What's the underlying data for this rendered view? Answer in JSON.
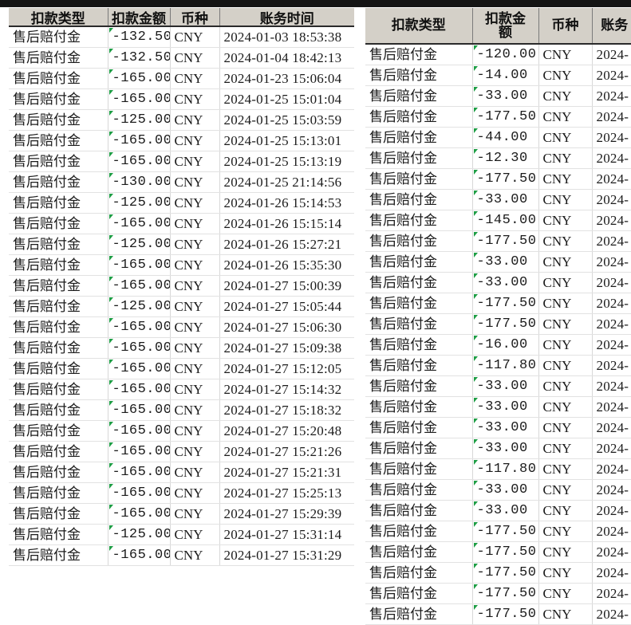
{
  "app": {
    "kind": "spreadsheet-screenshot",
    "note": "two side-by-side spreadsheet regions of a deduction detail sheet"
  },
  "colors": {
    "header_fill": "#d4d0c8",
    "header_rule": "#2b2b2b",
    "grid_line": "#e2e2e2",
    "comment_marker": "#1e9e45",
    "text": "#1b1b1b",
    "page_background": "#ffffff",
    "top_strip": "#141414"
  },
  "left_table": {
    "name": "left-deduction-table",
    "headers": [
      "扣款类型",
      "扣款金额",
      "币种",
      "账务时间"
    ],
    "header_clipped": true,
    "rows": [
      {
        "type": "售后赔付金",
        "amount": "-132.50",
        "currency": "CNY",
        "datetime": "2024-01-03  18:53:38"
      },
      {
        "type": "售后赔付金",
        "amount": "-132.50",
        "currency": "CNY",
        "datetime": "2024-01-04  18:42:13"
      },
      {
        "type": "售后赔付金",
        "amount": "-165.00",
        "currency": "CNY",
        "datetime": "2024-01-23  15:06:04"
      },
      {
        "type": "售后赔付金",
        "amount": "-165.00",
        "currency": "CNY",
        "datetime": "2024-01-25  15:01:04"
      },
      {
        "type": "售后赔付金",
        "amount": "-125.00",
        "currency": "CNY",
        "datetime": "2024-01-25  15:03:59"
      },
      {
        "type": "售后赔付金",
        "amount": "-165.00",
        "currency": "CNY",
        "datetime": "2024-01-25  15:13:01"
      },
      {
        "type": "售后赔付金",
        "amount": "-165.00",
        "currency": "CNY",
        "datetime": "2024-01-25  15:13:19"
      },
      {
        "type": "售后赔付金",
        "amount": "-130.00",
        "currency": "CNY",
        "datetime": "2024-01-25  21:14:56"
      },
      {
        "type": "售后赔付金",
        "amount": "-125.00",
        "currency": "CNY",
        "datetime": "2024-01-26  15:14:53"
      },
      {
        "type": "售后赔付金",
        "amount": "-165.00",
        "currency": "CNY",
        "datetime": "2024-01-26  15:15:14"
      },
      {
        "type": "售后赔付金",
        "amount": "-125.00",
        "currency": "CNY",
        "datetime": "2024-01-26  15:27:21"
      },
      {
        "type": "售后赔付金",
        "amount": "-165.00",
        "currency": "CNY",
        "datetime": "2024-01-26  15:35:30"
      },
      {
        "type": "售后赔付金",
        "amount": "-165.00",
        "currency": "CNY",
        "datetime": "2024-01-27  15:00:39"
      },
      {
        "type": "售后赔付金",
        "amount": "-125.00",
        "currency": "CNY",
        "datetime": "2024-01-27  15:05:44"
      },
      {
        "type": "售后赔付金",
        "amount": "-165.00",
        "currency": "CNY",
        "datetime": "2024-01-27  15:06:30"
      },
      {
        "type": "售后赔付金",
        "amount": "-165.00",
        "currency": "CNY",
        "datetime": "2024-01-27  15:09:38"
      },
      {
        "type": "售后赔付金",
        "amount": "-165.00",
        "currency": "CNY",
        "datetime": "2024-01-27  15:12:05"
      },
      {
        "type": "售后赔付金",
        "amount": "-165.00",
        "currency": "CNY",
        "datetime": "2024-01-27  15:14:32"
      },
      {
        "type": "售后赔付金",
        "amount": "-165.00",
        "currency": "CNY",
        "datetime": "2024-01-27  15:18:32"
      },
      {
        "type": "售后赔付金",
        "amount": "-165.00",
        "currency": "CNY",
        "datetime": "2024-01-27  15:20:48"
      },
      {
        "type": "售后赔付金",
        "amount": "-165.00",
        "currency": "CNY",
        "datetime": "2024-01-27  15:21:26"
      },
      {
        "type": "售后赔付金",
        "amount": "-165.00",
        "currency": "CNY",
        "datetime": "2024-01-27  15:21:31"
      },
      {
        "type": "售后赔付金",
        "amount": "-165.00",
        "currency": "CNY",
        "datetime": "2024-01-27  15:25:13"
      },
      {
        "type": "售后赔付金",
        "amount": "-165.00",
        "currency": "CNY",
        "datetime": "2024-01-27  15:29:39"
      },
      {
        "type": "售后赔付金",
        "amount": "-125.00",
        "currency": "CNY",
        "datetime": "2024-01-27  15:31:14"
      },
      {
        "type": "售后赔付金",
        "amount": "-165.00",
        "currency": "CNY",
        "datetime": "2024-01-27  15:31:29"
      }
    ]
  },
  "right_table": {
    "name": "right-deduction-table",
    "headers": [
      "扣款类型",
      "扣款金\n额",
      "币种",
      "账务"
    ],
    "header_last_truncated": true,
    "rows": [
      {
        "type": "售后赔付金",
        "amount": "-120.00",
        "currency": "CNY",
        "datetime": "2024-"
      },
      {
        "type": "售后赔付金",
        "amount": "-14.00",
        "currency": "CNY",
        "datetime": "2024-"
      },
      {
        "type": "售后赔付金",
        "amount": "-33.00",
        "currency": "CNY",
        "datetime": "2024-"
      },
      {
        "type": "售后赔付金",
        "amount": "-177.50",
        "currency": "CNY",
        "datetime": "2024-"
      },
      {
        "type": "售后赔付金",
        "amount": "-44.00",
        "currency": "CNY",
        "datetime": "2024-"
      },
      {
        "type": "售后赔付金",
        "amount": "-12.30",
        "currency": "CNY",
        "datetime": "2024-"
      },
      {
        "type": "售后赔付金",
        "amount": "-177.50",
        "currency": "CNY",
        "datetime": "2024-"
      },
      {
        "type": "售后赔付金",
        "amount": "-33.00",
        "currency": "CNY",
        "datetime": "2024-"
      },
      {
        "type": "售后赔付金",
        "amount": "-145.00",
        "currency": "CNY",
        "datetime": "2024-"
      },
      {
        "type": "售后赔付金",
        "amount": "-177.50",
        "currency": "CNY",
        "datetime": "2024-"
      },
      {
        "type": "售后赔付金",
        "amount": "-33.00",
        "currency": "CNY",
        "datetime": "2024-"
      },
      {
        "type": "售后赔付金",
        "amount": "-33.00",
        "currency": "CNY",
        "datetime": "2024-"
      },
      {
        "type": "售后赔付金",
        "amount": "-177.50",
        "currency": "CNY",
        "datetime": "2024-"
      },
      {
        "type": "售后赔付金",
        "amount": "-177.50",
        "currency": "CNY",
        "datetime": "2024-"
      },
      {
        "type": "售后赔付金",
        "amount": "-16.00",
        "currency": "CNY",
        "datetime": "2024-"
      },
      {
        "type": "售后赔付金",
        "amount": "-117.80",
        "currency": "CNY",
        "datetime": "2024-"
      },
      {
        "type": "售后赔付金",
        "amount": "-33.00",
        "currency": "CNY",
        "datetime": "2024-"
      },
      {
        "type": "售后赔付金",
        "amount": "-33.00",
        "currency": "CNY",
        "datetime": "2024-"
      },
      {
        "type": "售后赔付金",
        "amount": "-33.00",
        "currency": "CNY",
        "datetime": "2024-"
      },
      {
        "type": "售后赔付金",
        "amount": "-33.00",
        "currency": "CNY",
        "datetime": "2024-"
      },
      {
        "type": "售后赔付金",
        "amount": "-117.80",
        "currency": "CNY",
        "datetime": "2024-"
      },
      {
        "type": "售后赔付金",
        "amount": "-33.00",
        "currency": "CNY",
        "datetime": "2024-"
      },
      {
        "type": "售后赔付金",
        "amount": "-33.00",
        "currency": "CNY",
        "datetime": "2024-"
      },
      {
        "type": "售后赔付金",
        "amount": "-177.50",
        "currency": "CNY",
        "datetime": "2024-"
      },
      {
        "type": "售后赔付金",
        "amount": "-177.50",
        "currency": "CNY",
        "datetime": "2024-"
      },
      {
        "type": "售后赔付金",
        "amount": "-177.50",
        "currency": "CNY",
        "datetime": "2024-"
      },
      {
        "type": "售后赔付金",
        "amount": "-177.50",
        "currency": "CNY",
        "datetime": "2024-"
      },
      {
        "type": "售后赔付金",
        "amount": "-177.50",
        "currency": "CNY",
        "datetime": "2024-"
      }
    ]
  }
}
